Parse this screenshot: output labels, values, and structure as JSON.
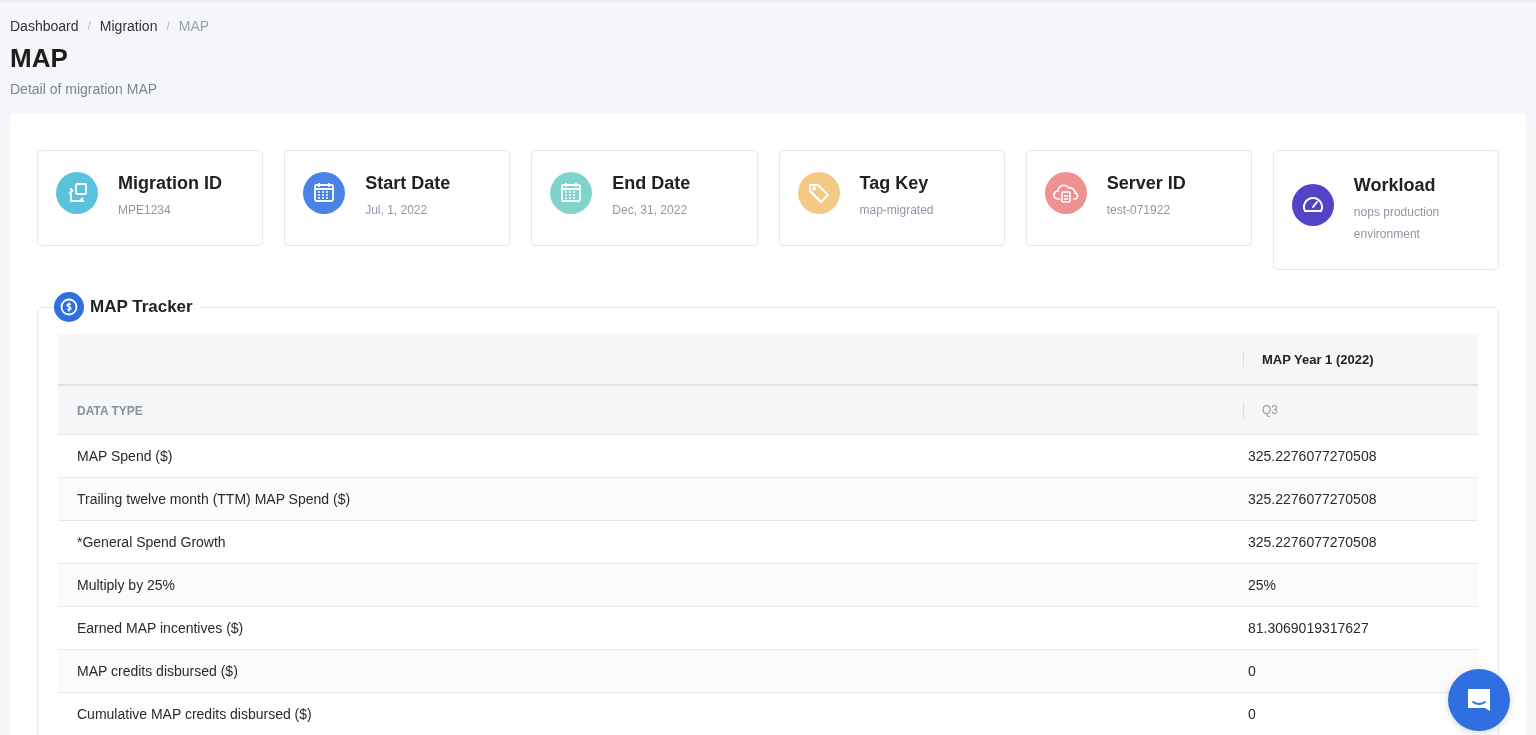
{
  "breadcrumb": [
    {
      "label": "Dashboard",
      "current": false
    },
    {
      "label": "Migration",
      "current": false
    },
    {
      "label": "MAP",
      "current": true
    }
  ],
  "breadcrumb_separator": "/",
  "page": {
    "title": "MAP",
    "subtitle": "Detail of migration MAP"
  },
  "cards": [
    {
      "kind": "migration",
      "color": "#5bc2dd",
      "title": "Migration ID",
      "value": "MPE1234"
    },
    {
      "kind": "calendar",
      "color": "#4a83e6",
      "title": "Start Date",
      "value": "Jul, 1, 2022"
    },
    {
      "kind": "calendar",
      "color": "#80d4cb",
      "title": "End Date",
      "value": "Dec, 31, 2022"
    },
    {
      "kind": "tag",
      "color": "#f4c983",
      "title": "Tag Key",
      "value": "map-migrated"
    },
    {
      "kind": "server",
      "color": "#ee9191",
      "title": "Server ID",
      "value": "test-071922"
    },
    {
      "kind": "gauge",
      "color": "#5243c8",
      "title": "Workload",
      "value": "nops production environment"
    }
  ],
  "tracker": {
    "title": "MAP Tracker",
    "table": {
      "group_header": "MAP Year 1 (2022)",
      "columns": [
        "DATA TYPE",
        "Q3"
      ],
      "rows": [
        [
          "MAP Spend ($)",
          "325.2276077270508"
        ],
        [
          "Trailing twelve month (TTM) MAP Spend ($)",
          "325.2276077270508"
        ],
        [
          "*General Spend Growth",
          "325.2276077270508"
        ],
        [
          "Multiply by 25%",
          "25%"
        ],
        [
          "Earned MAP incentives ($)",
          "81.3069019317627"
        ],
        [
          "MAP credits disbursed ($)",
          "0"
        ],
        [
          "Cumulative MAP credits disbursed ($)",
          "0"
        ]
      ]
    }
  }
}
